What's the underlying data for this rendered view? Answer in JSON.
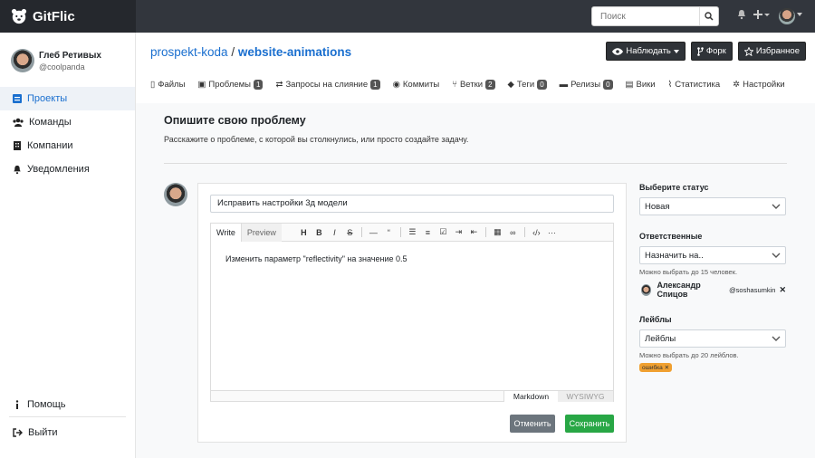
{
  "app": {
    "name": "GitFlic"
  },
  "header": {
    "search_placeholder": "Поиск"
  },
  "user": {
    "name": "Глеб Ретивых",
    "login": "@coolpanda"
  },
  "sidebar": {
    "items": [
      {
        "label": "Проекты"
      },
      {
        "label": "Команды"
      },
      {
        "label": "Компании"
      },
      {
        "label": "Уведомления"
      }
    ],
    "help": "Помощь",
    "logout": "Выйти"
  },
  "repo": {
    "owner": "prospekt-koda",
    "sep": "/",
    "name": "website-animations"
  },
  "actions": {
    "watch": "Наблюдать",
    "fork": "Форк",
    "favorite": "Избранное"
  },
  "tabs": [
    {
      "label": "Файлы"
    },
    {
      "label": "Проблемы",
      "count": "1"
    },
    {
      "label": "Запросы на слияние",
      "count": "1"
    },
    {
      "label": "Коммиты"
    },
    {
      "label": "Ветки",
      "count": "2"
    },
    {
      "label": "Теги",
      "count": "0"
    },
    {
      "label": "Релизы",
      "count": "0"
    },
    {
      "label": "Вики"
    },
    {
      "label": "Статистика"
    },
    {
      "label": "Настройки"
    }
  ],
  "issue": {
    "heading": "Опишите свою проблему",
    "subheading": "Расскажите о проблеме, с которой вы столкнулись, или просто создайте задачу.",
    "title_value": "Исправить настройки 3д модели",
    "write": "Write",
    "preview": "Preview",
    "body": "Изменить параметр \"reflectivity\" на значение 0.5",
    "markdown": "Markdown",
    "wysiwyg": "WYSIWYG",
    "cancel": "Отменить",
    "save": "Сохранить"
  },
  "side": {
    "status_label": "Выберите статус",
    "status_value": "Новая",
    "assign_label": "Ответственные",
    "assign_placeholder": "Назначить на..",
    "assign_hint": "Можно выбрать до 15 человек.",
    "assignee_name": "Александр Спицов",
    "assignee_login": "@soshasumkin",
    "labels_label": "Лейблы",
    "labels_placeholder": "Лейблы",
    "labels_hint": "Можно выбрать до 20 лейблов.",
    "tag": "ошибка ✕"
  }
}
